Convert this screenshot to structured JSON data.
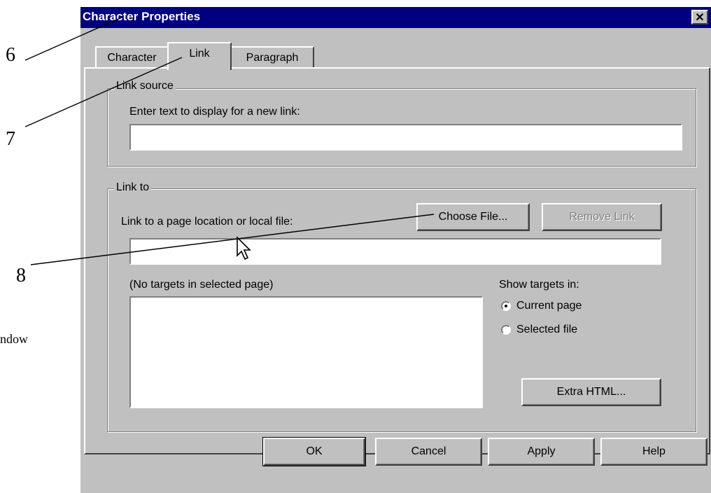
{
  "callouts": {
    "n6": "6",
    "n7": "7",
    "n8": "8"
  },
  "side_text": "ndow",
  "dialog": {
    "title": "Character Properties",
    "close_symbol": "✕",
    "tabs": [
      {
        "label": "Character",
        "active": false
      },
      {
        "label": "Link",
        "active": true
      },
      {
        "label": "Paragraph",
        "active": false
      }
    ],
    "link_source": {
      "legend": "Link source",
      "prompt": "Enter text to display for a new link:",
      "value": ""
    },
    "link_to": {
      "legend": "Link to",
      "prompt": "Link to a page location or local file:",
      "choose_file": "Choose File...",
      "remove_link": "Remove Link",
      "value": "",
      "targets_label": "(No targets in selected page)",
      "show_targets_label": "Show targets in:",
      "options": [
        {
          "label": "Current page",
          "checked": true
        },
        {
          "label": "Selected file",
          "checked": false
        }
      ],
      "extra_html": "Extra HTML..."
    },
    "buttons": {
      "ok": "OK",
      "cancel": "Cancel",
      "apply": "Apply",
      "help": "Help"
    }
  },
  "icons": {
    "cursor": "arrow-cursor-icon",
    "close": "close-icon"
  },
  "colors": {
    "titlebar": "#000080",
    "face": "#c0c0c0"
  }
}
